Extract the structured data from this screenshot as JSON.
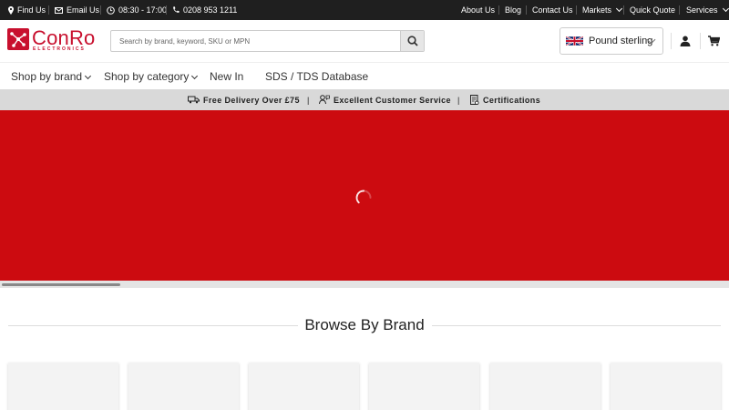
{
  "topbar": {
    "find_us": "Find Us",
    "email_us": "Email Us",
    "hours": "08:30 - 17:00",
    "phone": "0208 953 1211",
    "about": "About Us",
    "blog": "Blog",
    "contact": "Contact Us",
    "markets": "Markets",
    "quick_quote": "Quick Quote",
    "services": "Services"
  },
  "header": {
    "logo_name": "ConRo",
    "logo_sub": "ELECTRONICS",
    "search_placeholder": "Search by brand, keyword, SKU or MPN",
    "currency": "Pound sterling"
  },
  "nav": {
    "shop_by_brand": "Shop by brand",
    "shop_by_category": "Shop by category",
    "new_in": "New In",
    "sds": "SDS / TDS Database"
  },
  "strip": {
    "delivery": "Free Delivery Over £75",
    "service": "Excellent Customer Service",
    "certifications": "Certifications",
    "separator": "|"
  },
  "browse": {
    "title": "Browse By Brand",
    "card_count": 6
  },
  "colors": {
    "brand_red": "#cc0b10",
    "topbar_bg": "#1f1f1f",
    "strip_bg": "#d9d9d9"
  }
}
